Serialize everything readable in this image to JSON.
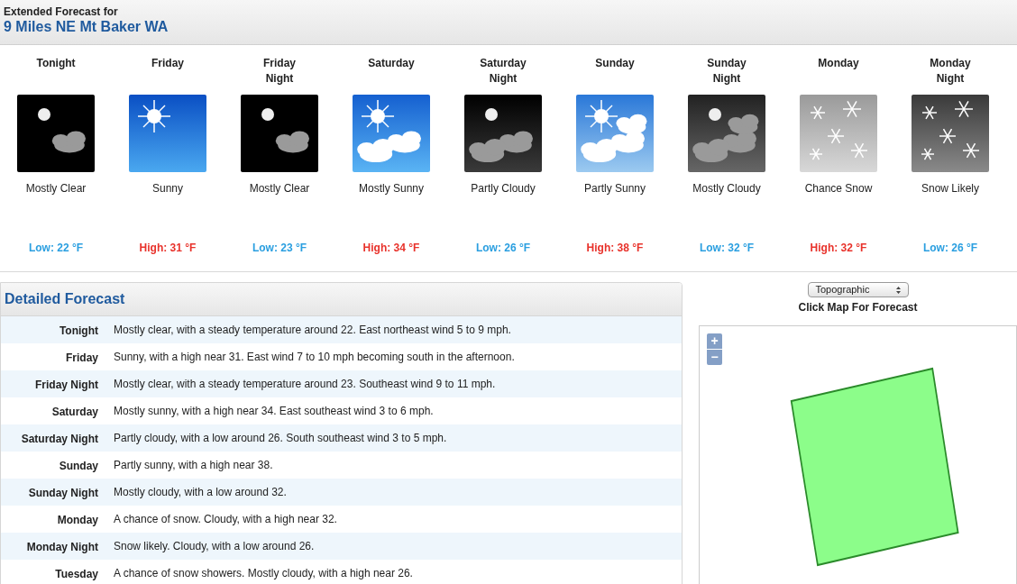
{
  "header": {
    "subtitle": "Extended Forecast for",
    "location": "9 Miles NE Mt Baker WA"
  },
  "periods": [
    {
      "name": "Tonight",
      "kind": "clear_night",
      "summary": "Mostly Clear",
      "temp": {
        "kind": "low",
        "text": "Low: 22 °F"
      }
    },
    {
      "name": "Friday",
      "kind": "sunny",
      "summary": "Sunny",
      "temp": {
        "kind": "high",
        "text": "High: 31 °F"
      }
    },
    {
      "name": "Friday Night",
      "kind": "clear_night",
      "summary": "Mostly Clear",
      "temp": {
        "kind": "low",
        "text": "Low: 23 °F"
      }
    },
    {
      "name": "Saturday",
      "kind": "mostly_sunny",
      "summary": "Mostly Sunny",
      "temp": {
        "kind": "high",
        "text": "High: 34 °F"
      }
    },
    {
      "name": "Saturday Night",
      "kind": "partly_cloudy_night",
      "summary": "Partly Cloudy",
      "temp": {
        "kind": "low",
        "text": "Low: 26 °F"
      }
    },
    {
      "name": "Sunday",
      "kind": "partly_sunny",
      "summary": "Partly Sunny",
      "temp": {
        "kind": "high",
        "text": "High: 38 °F"
      }
    },
    {
      "name": "Sunday Night",
      "kind": "mostly_cloudy_night",
      "summary": "Mostly Cloudy",
      "temp": {
        "kind": "low",
        "text": "Low: 32 °F"
      }
    },
    {
      "name": "Monday",
      "kind": "chance_snow",
      "summary": "Chance Snow",
      "temp": {
        "kind": "high",
        "text": "High: 32 °F"
      }
    },
    {
      "name": "Monday Night",
      "kind": "snow_likely",
      "summary": "Snow Likely",
      "temp": {
        "kind": "low",
        "text": "Low: 26 °F"
      }
    }
  ],
  "detailed": {
    "title": "Detailed Forecast",
    "rows": [
      {
        "period": "Tonight",
        "text": "Mostly clear, with a steady temperature around 22. East northeast wind 5 to 9 mph."
      },
      {
        "period": "Friday",
        "text": "Sunny, with a high near 31. East wind 7 to 10 mph becoming south in the afternoon."
      },
      {
        "period": "Friday Night",
        "text": "Mostly clear, with a steady temperature around 23. Southeast wind 9 to 11 mph."
      },
      {
        "period": "Saturday",
        "text": "Mostly sunny, with a high near 34. East southeast wind 3 to 6 mph."
      },
      {
        "period": "Saturday Night",
        "text": "Partly cloudy, with a low around 26. South southeast wind 3 to 5 mph."
      },
      {
        "period": "Sunday",
        "text": "Partly sunny, with a high near 38."
      },
      {
        "period": "Sunday Night",
        "text": "Mostly cloudy, with a low around 32."
      },
      {
        "period": "Monday",
        "text": "A chance of snow. Cloudy, with a high near 32."
      },
      {
        "period": "Monday Night",
        "text": "Snow likely. Cloudy, with a low around 26."
      },
      {
        "period": "Tuesday",
        "text": "A chance of snow showers. Mostly cloudy, with a high near 26."
      }
    ]
  },
  "map": {
    "layer_select": "Topographic",
    "caption": "Click Map For Forecast",
    "zoom_in": "+",
    "zoom_out": "−"
  }
}
